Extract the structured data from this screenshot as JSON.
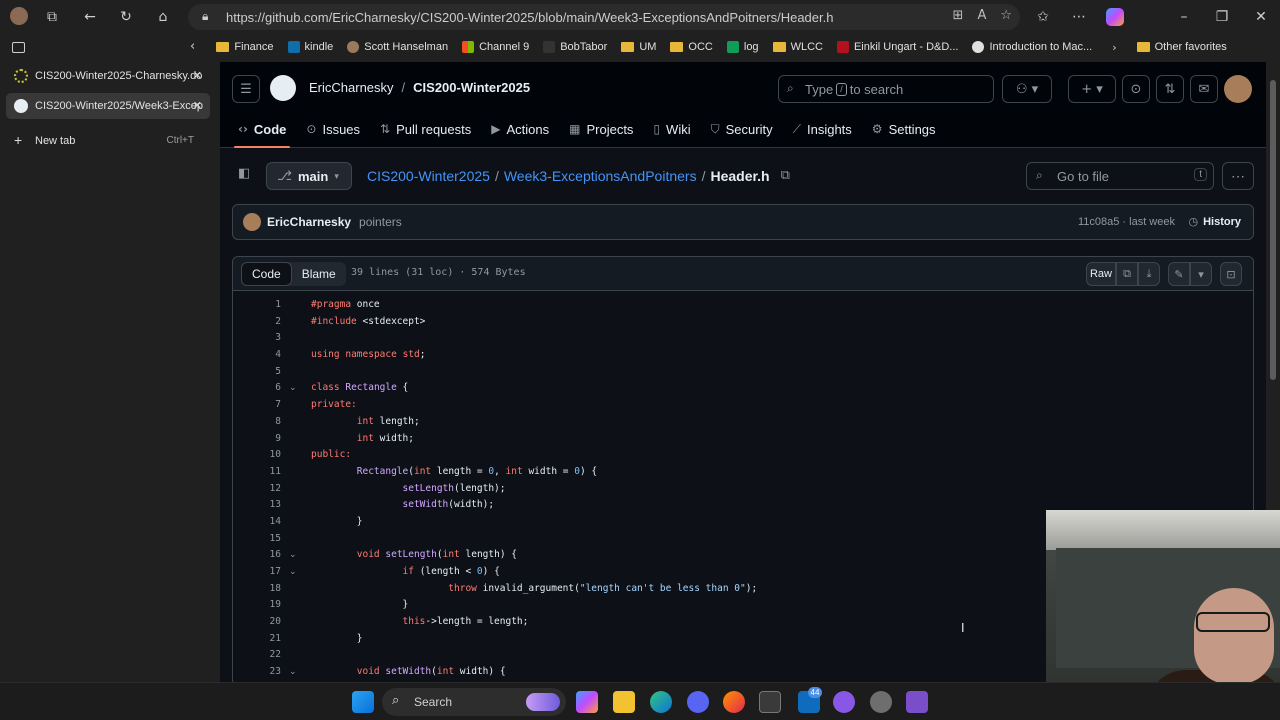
{
  "browser": {
    "url": "https://github.com/EricCharnesky/CIS200-Winter2025/blob/main/Week3-ExceptionsAndPoitners/Header.h",
    "favorites": [
      {
        "label": "Finance",
        "icon": "folder-icon"
      },
      {
        "label": "kindle",
        "icon": "kindle-icon"
      },
      {
        "label": "Scott Hanselman",
        "icon": "person-icon"
      },
      {
        "label": "Channel 9",
        "icon": "channel9-icon"
      },
      {
        "label": "BobTabor",
        "icon": "bobtabor-icon"
      },
      {
        "label": "UM",
        "icon": "folder-icon"
      },
      {
        "label": "OCC",
        "icon": "folder-icon"
      },
      {
        "label": "log",
        "icon": "sheets-icon"
      },
      {
        "label": "WLCC",
        "icon": "folder-icon"
      },
      {
        "label": "Einkil Ungart - D&D...",
        "icon": "dnd-icon"
      },
      {
        "label": "Introduction to Mac...",
        "icon": "google-icon"
      }
    ],
    "other_favorites": "Other favorites",
    "tabs": [
      {
        "label": "CIS200-Winter2025-Charnesky.do",
        "active": false
      },
      {
        "label": "CIS200-Winter2025/Week3-Excep",
        "active": true
      }
    ],
    "new_tab": "New tab",
    "new_tab_shortcut": "Ctrl+T"
  },
  "github": {
    "owner": "EricCharnesky",
    "repo": "CIS200-Winter2025",
    "search_placeholder_pre": "Type",
    "search_key": "/",
    "search_placeholder_post": "to search",
    "tabs": [
      {
        "label": "Code",
        "icon": "code-icon",
        "active": true
      },
      {
        "label": "Issues",
        "icon": "issue-icon"
      },
      {
        "label": "Pull requests",
        "icon": "pull-request-icon"
      },
      {
        "label": "Actions",
        "icon": "play-icon"
      },
      {
        "label": "Projects",
        "icon": "table-icon"
      },
      {
        "label": "Wiki",
        "icon": "book-icon"
      },
      {
        "label": "Security",
        "icon": "shield-icon"
      },
      {
        "label": "Insights",
        "icon": "graph-icon"
      },
      {
        "label": "Settings",
        "icon": "gear-icon"
      }
    ],
    "branch": "main",
    "breadcrumb": {
      "repo": "CIS200-Winter2025",
      "folder": "Week3-ExceptionsAndPoitners",
      "file": "Header.h"
    },
    "goto_file": "Go to file",
    "goto_key": "t",
    "commit": {
      "author": "EricCharnesky",
      "message": "pointers",
      "sha_time": "11c08a5 · last week",
      "history": "History"
    },
    "file_view": {
      "code_label": "Code",
      "blame_label": "Blame",
      "info": "39 lines (31 loc) · 574 Bytes",
      "raw_label": "Raw"
    },
    "code_lines": [
      {
        "n": "1",
        "fold": false,
        "html": "<span class=\"pp\">#pragma</span> once"
      },
      {
        "n": "2",
        "fold": false,
        "html": "<span class=\"pp\">#include</span> &lt;stdexcept&gt;"
      },
      {
        "n": "3",
        "fold": false,
        "html": ""
      },
      {
        "n": "4",
        "fold": false,
        "html": "<span class=\"kw\">using</span> <span class=\"kw\">namespace</span> <span class=\"kw\">std</span>;"
      },
      {
        "n": "5",
        "fold": false,
        "html": ""
      },
      {
        "n": "6",
        "fold": true,
        "html": "<span class=\"kw\">class</span> <span class=\"fn\">Rectangle</span> {"
      },
      {
        "n": "7",
        "fold": false,
        "html": "<span class=\"kw\">private:</span>"
      },
      {
        "n": "8",
        "fold": false,
        "html": "        <span class=\"kw\">int</span> length;"
      },
      {
        "n": "9",
        "fold": false,
        "html": "        <span class=\"kw\">int</span> width;"
      },
      {
        "n": "10",
        "fold": false,
        "html": "<span class=\"kw\">public:</span>"
      },
      {
        "n": "11",
        "fold": false,
        "html": "        <span class=\"fn\">Rectangle</span>(<span class=\"kw\">int</span> length = <span class=\"nm\">0</span>, <span class=\"kw\">int</span> width = <span class=\"nm\">0</span>) {"
      },
      {
        "n": "12",
        "fold": false,
        "html": "                <span class=\"fn\">setLength</span>(length);"
      },
      {
        "n": "13",
        "fold": false,
        "html": "                <span class=\"fn\">setWidth</span>(width);"
      },
      {
        "n": "14",
        "fold": false,
        "html": "        }"
      },
      {
        "n": "15",
        "fold": false,
        "html": ""
      },
      {
        "n": "16",
        "fold": true,
        "html": "        <span class=\"kw\">void</span> <span class=\"fn\">setLength</span>(<span class=\"kw\">int</span> length) {"
      },
      {
        "n": "17",
        "fold": true,
        "html": "                <span class=\"kw\">if</span> (length &lt; <span class=\"nm\">0</span>) {"
      },
      {
        "n": "18",
        "fold": false,
        "html": "                        <span class=\"kw\">throw</span> invalid_argument(<span class=\"str\">\"length can't be less than 0\"</span>);"
      },
      {
        "n": "19",
        "fold": false,
        "html": "                }"
      },
      {
        "n": "20",
        "fold": false,
        "html": "                <span class=\"kw\">this</span>-&gt;length = length;"
      },
      {
        "n": "21",
        "fold": false,
        "html": "        }"
      },
      {
        "n": "22",
        "fold": false,
        "html": ""
      },
      {
        "n": "23",
        "fold": true,
        "html": "        <span class=\"kw\">void</span> <span class=\"fn\">setWidth</span>(<span class=\"kw\">int</span> width) {"
      }
    ]
  },
  "taskbar": {
    "search_label": "Search",
    "mail_badge": "44"
  },
  "colors": {
    "gh_bg": "#0d1117",
    "link": "#4493f8",
    "keyword": "#ff7b72",
    "function": "#d2a8ff",
    "string": "#a5d6ff",
    "active_tab_underline": "#f78166"
  }
}
